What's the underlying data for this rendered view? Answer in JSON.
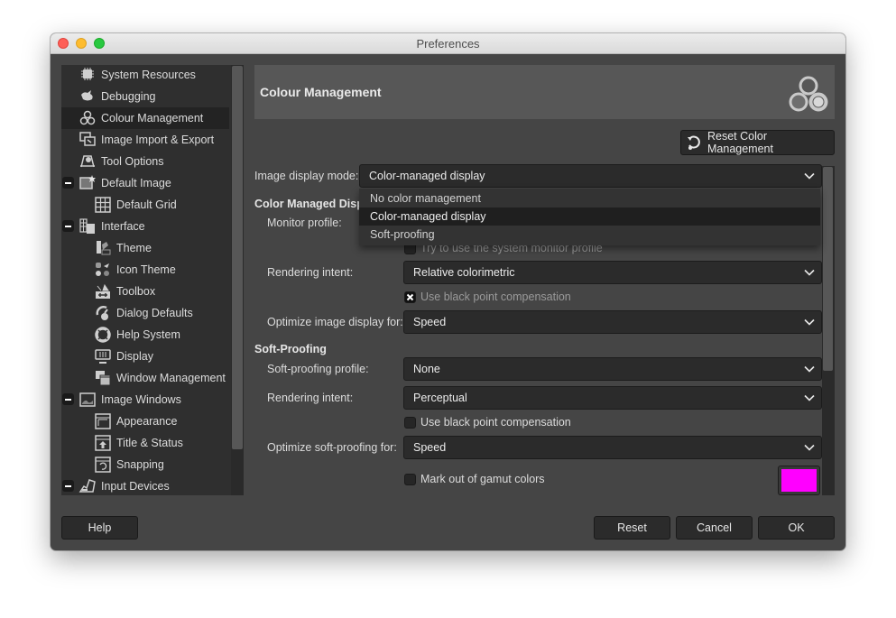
{
  "window": {
    "title": "Preferences"
  },
  "sidebar": {
    "items": [
      {
        "label": "System Resources",
        "icon": "chip-icon",
        "level": 0,
        "expander": false
      },
      {
        "label": "Debugging",
        "icon": "wilber-bug-icon",
        "level": 0,
        "expander": false
      },
      {
        "label": "Colour Management",
        "icon": "color-circles-icon",
        "level": 0,
        "expander": false,
        "selected": true
      },
      {
        "label": "Image Import & Export",
        "icon": "import-export-icon",
        "level": 0,
        "expander": false
      },
      {
        "label": "Tool Options",
        "icon": "tool-options-icon",
        "level": 0,
        "expander": false
      },
      {
        "label": "Default Image",
        "icon": "default-image-icon",
        "level": 0,
        "expander": true
      },
      {
        "label": "Default Grid",
        "icon": "grid-icon",
        "level": 1,
        "expander": false
      },
      {
        "label": "Interface",
        "icon": "interface-icon",
        "level": 0,
        "expander": true
      },
      {
        "label": "Theme",
        "icon": "theme-icon",
        "level": 1,
        "expander": false
      },
      {
        "label": "Icon Theme",
        "icon": "icon-theme-icon",
        "level": 1,
        "expander": false
      },
      {
        "label": "Toolbox",
        "icon": "toolbox-icon",
        "level": 1,
        "expander": false
      },
      {
        "label": "Dialog Defaults",
        "icon": "dialog-defaults-icon",
        "level": 1,
        "expander": false
      },
      {
        "label": "Help System",
        "icon": "lifebuoy-icon",
        "level": 1,
        "expander": false
      },
      {
        "label": "Display",
        "icon": "display-icon",
        "level": 1,
        "expander": false
      },
      {
        "label": "Window Management",
        "icon": "window-management-icon",
        "level": 1,
        "expander": false
      },
      {
        "label": "Image Windows",
        "icon": "image-windows-icon",
        "level": 0,
        "expander": true
      },
      {
        "label": "Appearance",
        "icon": "appearance-icon",
        "level": 1,
        "expander": false
      },
      {
        "label": "Title & Status",
        "icon": "title-status-icon",
        "level": 1,
        "expander": false
      },
      {
        "label": "Snapping",
        "icon": "snapping-icon",
        "level": 1,
        "expander": false
      },
      {
        "label": "Input Devices",
        "icon": "input-devices-icon",
        "level": 0,
        "expander": true
      }
    ]
  },
  "header": {
    "title": "Colour Management",
    "icon": "color-circles-icon"
  },
  "reset_color_button": "Reset Color Management",
  "display_mode": {
    "label": "Image display mode:",
    "value": "Color-managed display",
    "options": [
      "No color management",
      "Color-managed display",
      "Soft-proofing"
    ],
    "highlighted": "Color-managed display"
  },
  "color_managed": {
    "section": "Color Managed Display",
    "section_visible": "Color Managed Displ",
    "monitor_profile_label": "Monitor profile:",
    "system_monitor_checkbox": {
      "label": "Try to use the system monitor profile",
      "checked": false
    },
    "rendering_intent": {
      "label": "Rendering intent:",
      "value": "Relative colorimetric"
    },
    "black_point": {
      "label": "Use black point compensation",
      "checked": true
    },
    "optimize": {
      "label": "Optimize image display for:",
      "value": "Speed"
    }
  },
  "soft_proofing": {
    "section": "Soft-Proofing",
    "profile": {
      "label": "Soft-proofing profile:",
      "value": "None"
    },
    "rendering_intent": {
      "label": "Rendering intent:",
      "value": "Perceptual"
    },
    "black_point": {
      "label": "Use black point compensation",
      "checked": false
    },
    "optimize": {
      "label": "Optimize soft-proofing for:",
      "value": "Speed"
    },
    "gamut": {
      "label": "Mark out of gamut colors",
      "checked": false,
      "color": "#ff00ff"
    }
  },
  "footer": {
    "help": "Help",
    "reset": "Reset",
    "cancel": "Cancel",
    "ok": "OK"
  }
}
